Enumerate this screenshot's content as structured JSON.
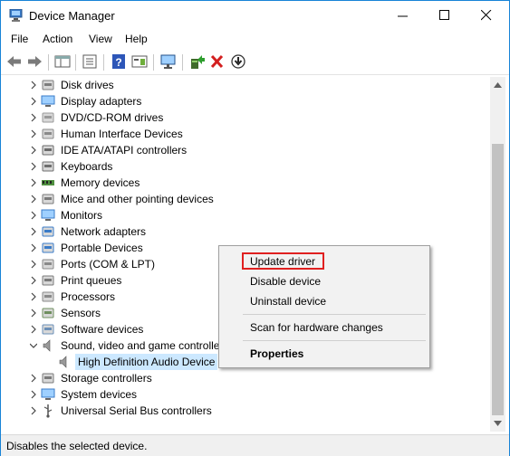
{
  "window": {
    "title": "Device Manager"
  },
  "menu": [
    "File",
    "Action",
    "View",
    "Help"
  ],
  "toolbar": {
    "buttons": [
      "back-icon",
      "forward-icon",
      "show-hide-console-tree-icon",
      "properties-icon",
      "help-icon",
      "action-pane-icon",
      "scan-hardware-icon",
      "update-driver-icon",
      "uninstall-icon",
      "disable-icon"
    ]
  },
  "tree": {
    "items": [
      {
        "label": "Disk drives",
        "icon": "disk-drive-icon"
      },
      {
        "label": "Display adapters",
        "icon": "display-adapter-icon"
      },
      {
        "label": "DVD/CD-ROM drives",
        "icon": "dvd-drive-icon"
      },
      {
        "label": "Human Interface Devices",
        "icon": "hid-icon"
      },
      {
        "label": "IDE ATA/ATAPI controllers",
        "icon": "ide-controller-icon"
      },
      {
        "label": "Keyboards",
        "icon": "keyboard-icon"
      },
      {
        "label": "Memory devices",
        "icon": "memory-icon"
      },
      {
        "label": "Mice and other pointing devices",
        "icon": "mouse-icon"
      },
      {
        "label": "Monitors",
        "icon": "monitor-icon"
      },
      {
        "label": "Network adapters",
        "icon": "network-adapter-icon"
      },
      {
        "label": "Portable Devices",
        "icon": "portable-device-icon"
      },
      {
        "label": "Ports (COM & LPT)",
        "icon": "port-icon"
      },
      {
        "label": "Print queues",
        "icon": "printer-icon"
      },
      {
        "label": "Processors",
        "icon": "processor-icon"
      },
      {
        "label": "Sensors",
        "icon": "sensor-icon"
      },
      {
        "label": "Software devices",
        "icon": "software-device-icon"
      },
      {
        "label": "Sound, video and game controllers",
        "icon": "speaker-icon"
      },
      {
        "label": "High Definition Audio Device",
        "icon": "speaker-icon"
      },
      {
        "label": "Storage controllers",
        "icon": "storage-controller-icon"
      },
      {
        "label": "System devices",
        "icon": "system-device-icon"
      },
      {
        "label": "Universal Serial Bus controllers",
        "icon": "usb-icon"
      }
    ]
  },
  "context_menu": {
    "update_driver": "Update driver",
    "disable_device": "Disable device",
    "uninstall_device": "Uninstall device",
    "scan": "Scan for hardware changes",
    "properties": "Properties"
  },
  "status": {
    "text": "Disables the selected device."
  },
  "colors": {
    "accent": "#1883d7",
    "selection": "#cce8ff",
    "highlight_box": "#e02020"
  }
}
